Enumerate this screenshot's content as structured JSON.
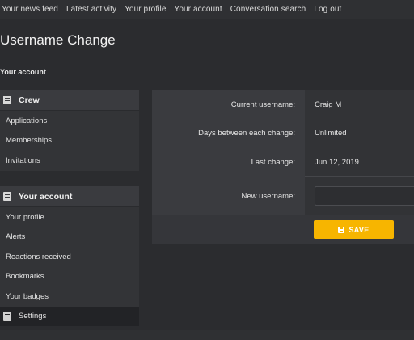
{
  "nav": {
    "items": [
      "Your news feed",
      "Latest activity",
      "Your profile",
      "Your account",
      "Conversation search",
      "Log out"
    ]
  },
  "page": {
    "title": "Username Change",
    "breadcrumb": "Your account"
  },
  "sidebar": {
    "crew": {
      "header": "Crew",
      "items": [
        "Applications",
        "Memberships",
        "Invitations"
      ]
    },
    "account": {
      "header": "Your account",
      "items": [
        "Your profile",
        "Alerts",
        "Reactions received",
        "Bookmarks",
        "Your badges"
      ],
      "active_item": "Settings"
    }
  },
  "form": {
    "rows": [
      {
        "label": "Current username:",
        "value": "Craig M"
      },
      {
        "label": "Days between each change:",
        "value": "Unlimited"
      },
      {
        "label": "Last change:",
        "value": "Jun 12, 2019"
      }
    ],
    "new_username": {
      "label": "New username:",
      "value": "",
      "placeholder": ""
    },
    "save_label": "SAVE"
  },
  "colors": {
    "accent": "#f7b500",
    "background": "#2b2c2f",
    "panel": "#3a3b3f"
  },
  "icons": {
    "sidebar_header": "document-icon",
    "save": "floppy-disk-icon"
  }
}
